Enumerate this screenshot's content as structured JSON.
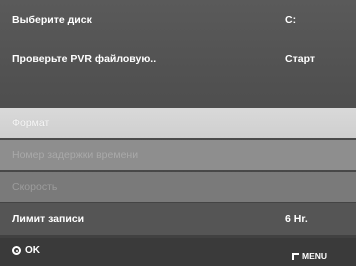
{
  "menu": {
    "items": [
      {
        "label": "Выберите диск",
        "value": "C:"
      },
      {
        "label": "Проверьте PVR файловую..",
        "value": "Старт"
      },
      {
        "label": "",
        "value": ""
      },
      {
        "label": "Формат",
        "value": ""
      },
      {
        "label": "Номер задержки времени",
        "value": ""
      },
      {
        "label": "Скорость",
        "value": ""
      },
      {
        "label": "Лимит записи",
        "value": "6 Hr."
      }
    ],
    "selected_index": 3
  },
  "footer": {
    "ok_label": "OK",
    "menu_label": "MENU"
  },
  "icons": {
    "ok": "ok-circle-icon",
    "menu": "return-arrow-icon"
  }
}
